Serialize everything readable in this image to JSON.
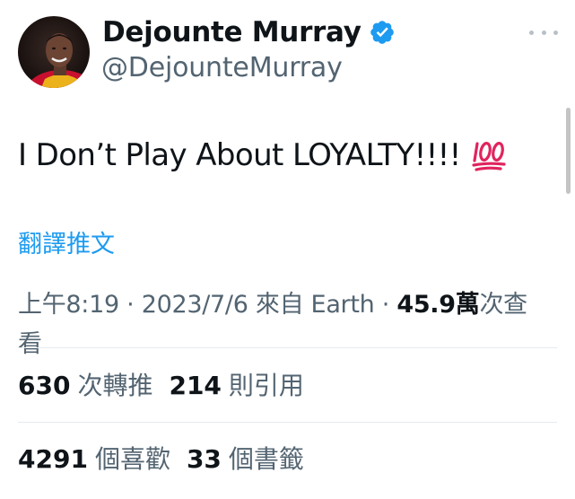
{
  "author": {
    "display_name": "Dejounte Murray",
    "handle": "@DejounteMurray",
    "verified": true,
    "avatar": "profile-photo"
  },
  "tweet": {
    "text": "I Don’t Play About LOYALTY!!!!",
    "emoji": "hundred-points-icon"
  },
  "translate_label": "翻譯推文",
  "meta": {
    "time": "上午8:19",
    "separator": " · ",
    "date": "2023/7/6",
    "source": "來自 Earth",
    "views_count": "45.9萬",
    "views_label": "次查看"
  },
  "stats": {
    "retweets": {
      "count": "630",
      "label": "次轉推"
    },
    "quotes": {
      "count": "214",
      "label": "則引用"
    },
    "likes": {
      "count": "4291",
      "label": "個喜歡"
    },
    "bookmarks": {
      "count": "33",
      "label": "個書籤"
    }
  },
  "colors": {
    "text": "#0f1419",
    "secondary": "#536471",
    "link": "#1d9bf0",
    "verified": "#1d9bf0",
    "divider": "#e6ebef",
    "emoji": "#e0245e"
  }
}
